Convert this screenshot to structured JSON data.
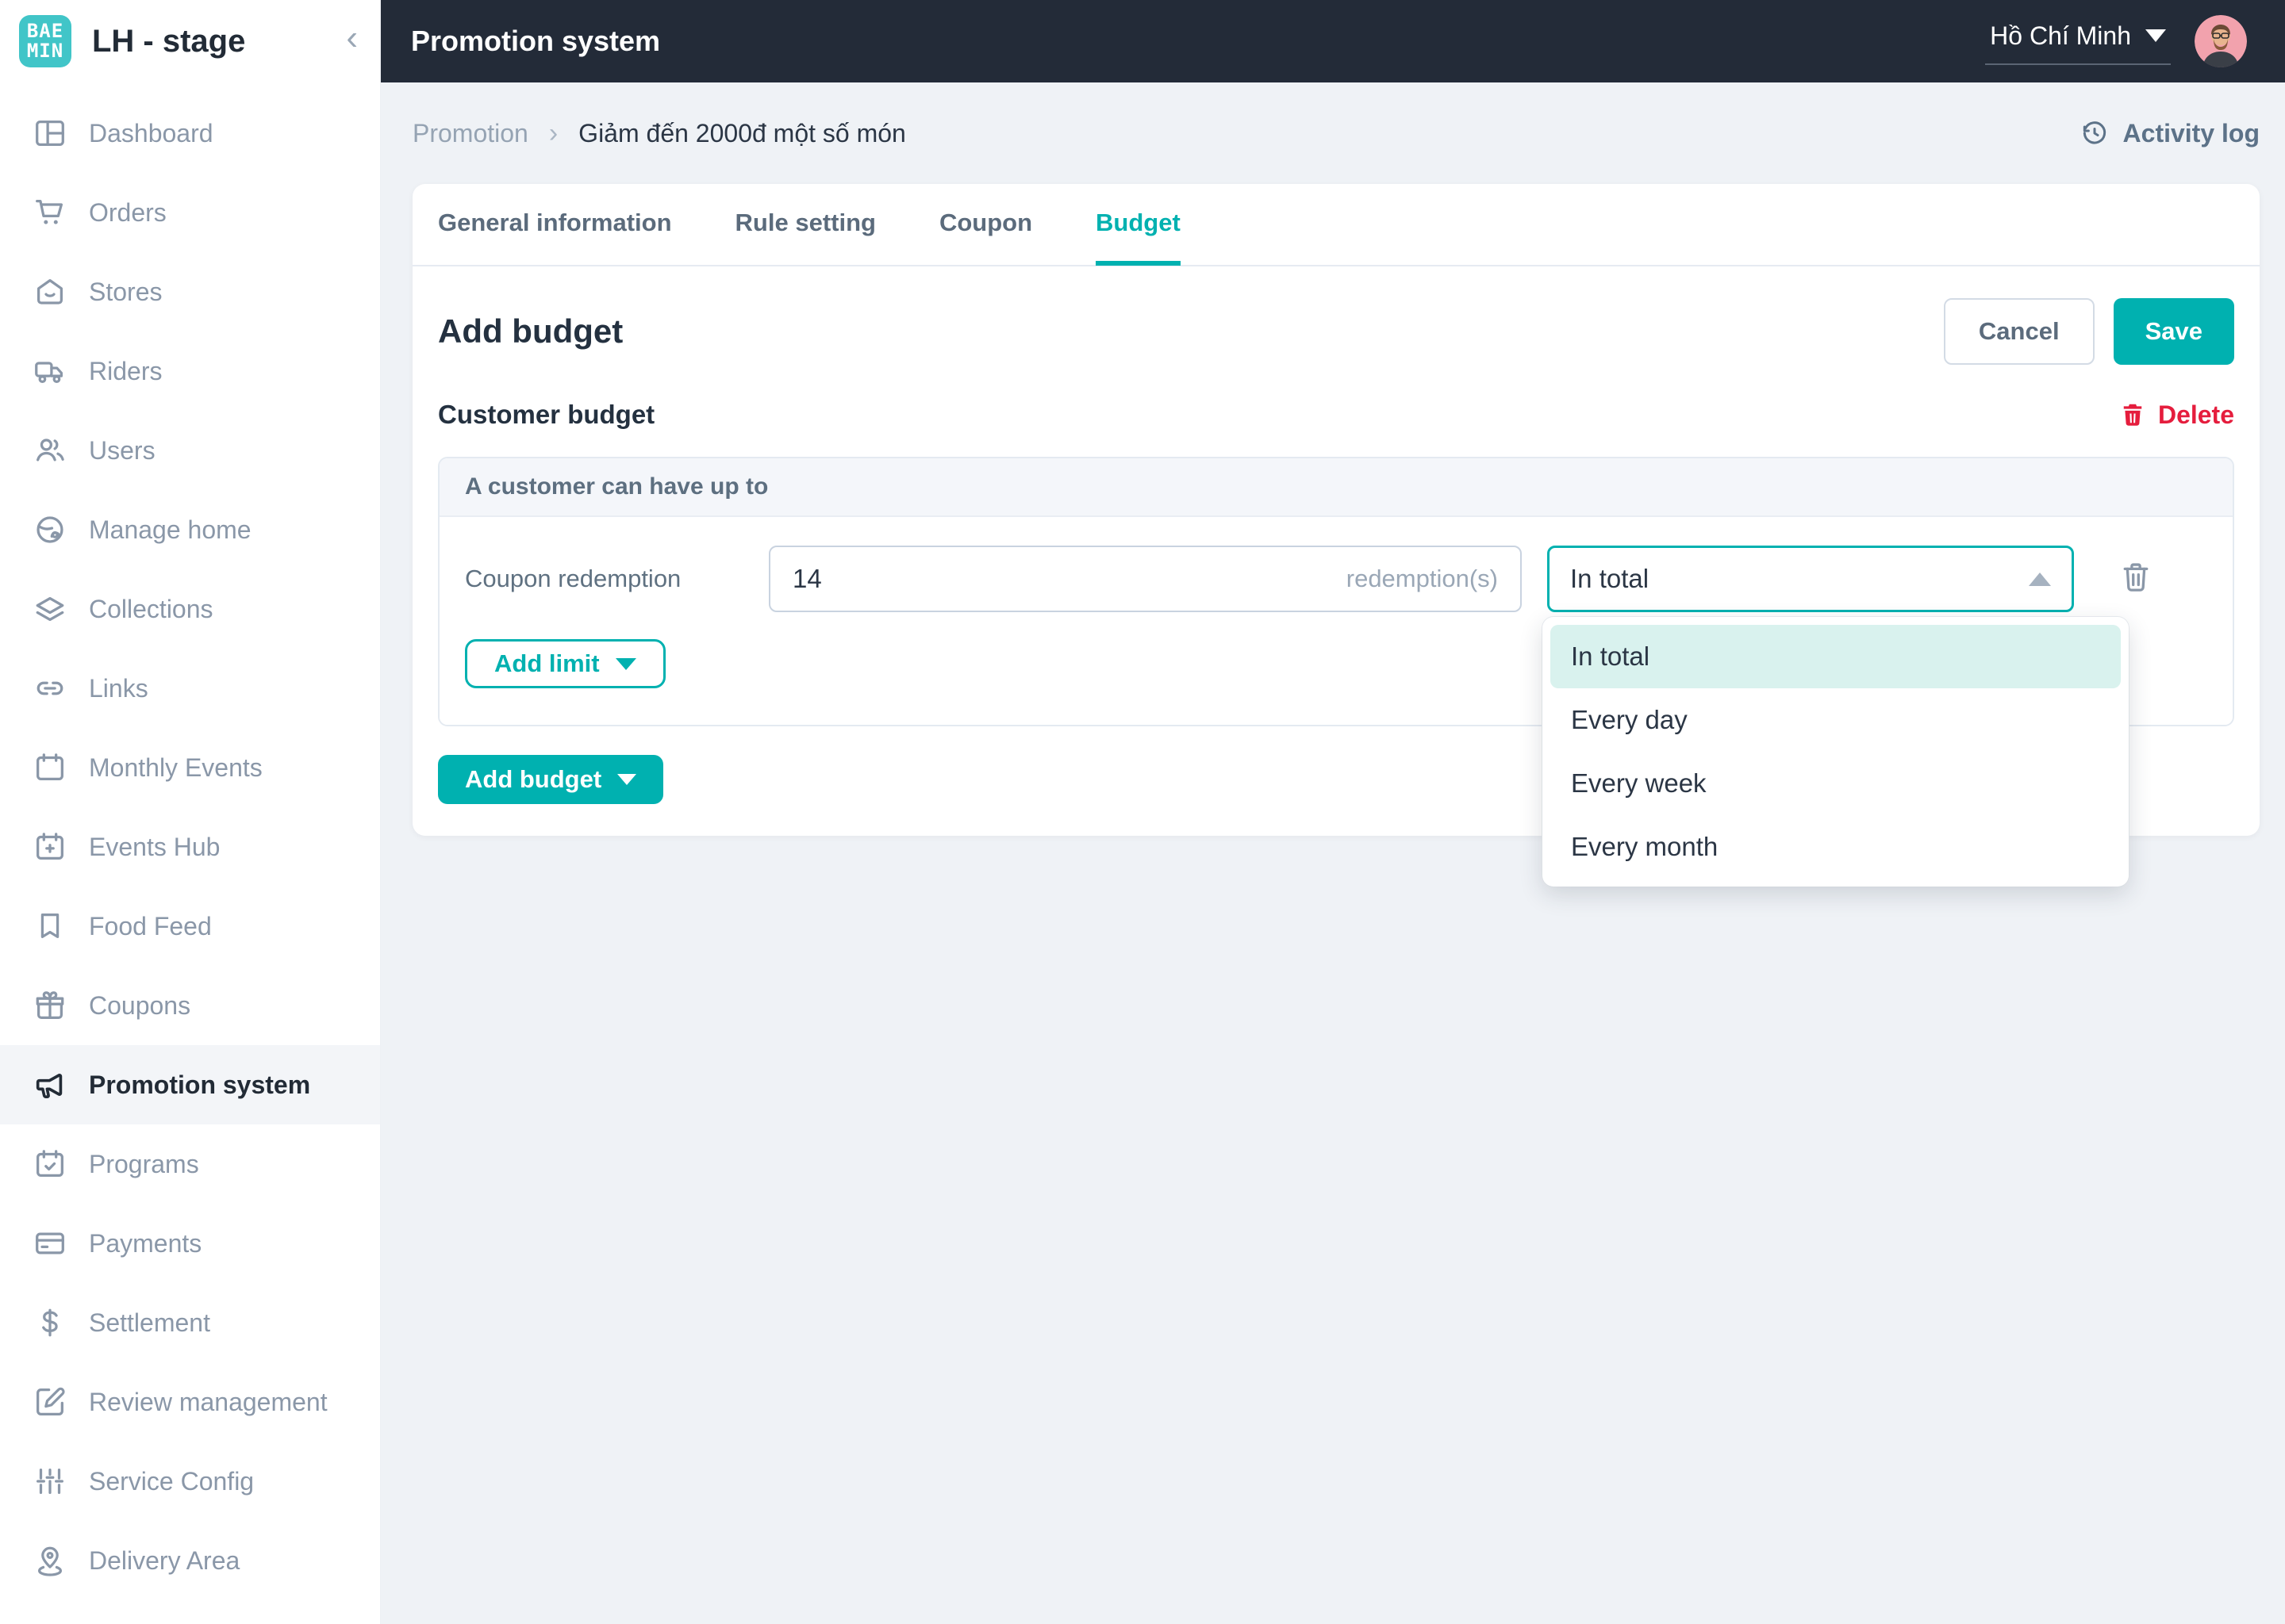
{
  "brand": {
    "logo_line1": "BAE",
    "logo_line2": "MIN",
    "workspace": "LH - stage"
  },
  "header": {
    "title": "Promotion system",
    "region": "Hồ Chí Minh"
  },
  "sidebar": {
    "items": [
      {
        "label": "Dashboard",
        "icon": "dashboard-icon",
        "active": false
      },
      {
        "label": "Orders",
        "icon": "cart-icon",
        "active": false
      },
      {
        "label": "Stores",
        "icon": "store-icon",
        "active": false
      },
      {
        "label": "Riders",
        "icon": "truck-icon",
        "active": false
      },
      {
        "label": "Users",
        "icon": "users-icon",
        "active": false
      },
      {
        "label": "Manage home",
        "icon": "globe-icon",
        "active": false
      },
      {
        "label": "Collections",
        "icon": "layers-icon",
        "active": false
      },
      {
        "label": "Links",
        "icon": "link-icon",
        "active": false
      },
      {
        "label": "Monthly Events",
        "icon": "calendar-icon",
        "active": false
      },
      {
        "label": "Events Hub",
        "icon": "calendar-plus-icon",
        "active": false
      },
      {
        "label": "Food Feed",
        "icon": "bookmark-icon",
        "active": false
      },
      {
        "label": "Coupons",
        "icon": "gift-icon",
        "active": false
      },
      {
        "label": "Promotion system",
        "icon": "megaphone-icon",
        "active": true
      },
      {
        "label": "Programs",
        "icon": "calendar-check-icon",
        "active": false
      },
      {
        "label": "Payments",
        "icon": "credit-card-icon",
        "active": false
      },
      {
        "label": "Settlement",
        "icon": "dollar-icon",
        "active": false
      },
      {
        "label": "Review management",
        "icon": "edit-icon",
        "active": false
      },
      {
        "label": "Service Config",
        "icon": "sliders-icon",
        "active": false
      },
      {
        "label": "Delivery Area",
        "icon": "map-pin-icon",
        "active": false
      }
    ]
  },
  "breadcrumb": {
    "parent": "Promotion",
    "current": "Giảm đến 2000đ một số món",
    "activity_log": "Activity log"
  },
  "tabs": [
    {
      "label": "General information",
      "active": false
    },
    {
      "label": "Rule setting",
      "active": false
    },
    {
      "label": "Coupon",
      "active": false
    },
    {
      "label": "Budget",
      "active": true
    }
  ],
  "budget": {
    "heading": "Add budget",
    "cancel_label": "Cancel",
    "save_label": "Save",
    "section_title": "Customer budget",
    "delete_label": "Delete",
    "box_header": "A customer can have up to",
    "row_label": "Coupon redemption",
    "redemption_value": "14",
    "redemption_unit": "redemption(s)",
    "frequency_value": "In total",
    "add_limit_label": "Add limit",
    "add_budget_label": "Add budget",
    "dropdown_options": [
      {
        "label": "In total",
        "selected": true
      },
      {
        "label": "Every day",
        "selected": false
      },
      {
        "label": "Every week",
        "selected": false
      },
      {
        "label": "Every month",
        "selected": false
      }
    ]
  },
  "colors": {
    "accent_teal": "#00b1b0",
    "logo_teal": "#41c5c8",
    "header_dark": "#232b38",
    "danger_red": "#e51d3d",
    "dropdown_highlight": "#d9f2ee"
  }
}
